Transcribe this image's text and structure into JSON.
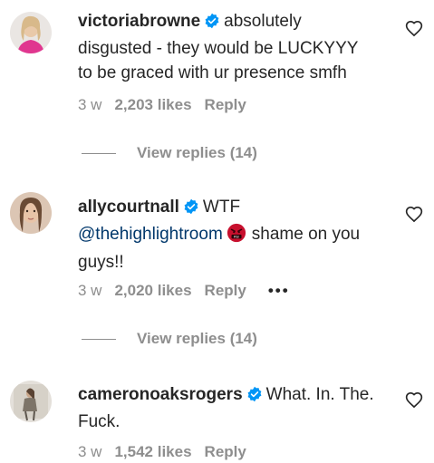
{
  "comments": [
    {
      "username": "victoriabrowne",
      "text": "absolutely disgusted - they would be LUCKYYY to be graced with ur presence smfh",
      "time": "3 w",
      "likes": "2,203 likes",
      "reply": "Reply",
      "view_replies": "View replies (14)"
    },
    {
      "username": "allycourtnall",
      "text_prefix": "WTF",
      "mention": "@thehighlightroom",
      "text_suffix": "shame on you guys!!",
      "time": "3 w",
      "likes": "2,020 likes",
      "reply": "Reply",
      "more": "•••",
      "view_replies": "View replies (14)"
    },
    {
      "username": "cameronoaksrogers",
      "text": "What. In. The. Fuck.",
      "time": "3 w",
      "likes": "1,542 likes",
      "reply": "Reply"
    }
  ],
  "icons": {
    "verified_color": "#0095f6",
    "heart_stroke": "#262626"
  }
}
